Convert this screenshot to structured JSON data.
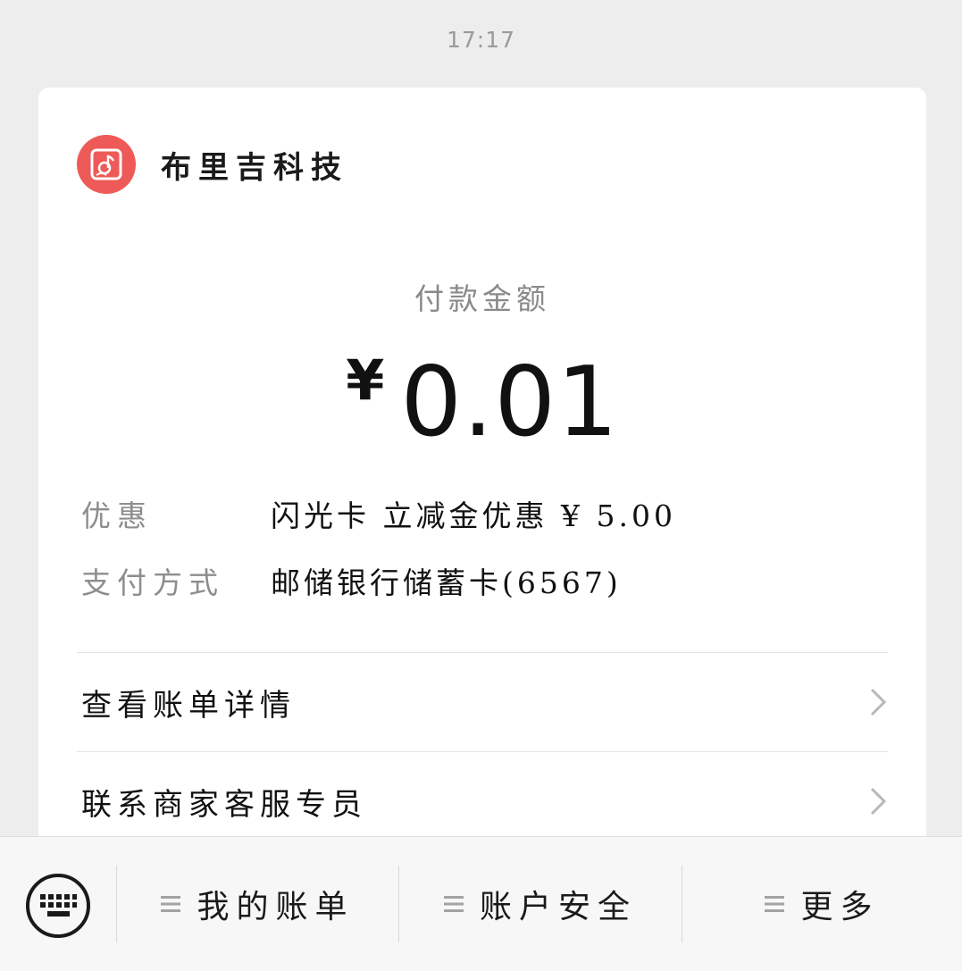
{
  "header": {
    "timestamp": "17:17"
  },
  "merchant": {
    "name": "布里吉科技",
    "logo_color": "#ee5a57",
    "logo_icon": "music-note-icon"
  },
  "payment": {
    "amount_label": "付款金额",
    "currency_symbol": "¥",
    "amount": "0.01"
  },
  "details": [
    {
      "label": "优惠",
      "value": "闪光卡 立减金优惠 ¥ 5.00"
    },
    {
      "label": "支付方式",
      "value": "邮储银行储蓄卡(6567)"
    }
  ],
  "links": [
    {
      "label": "查看账单详情",
      "icon": "chevron-right-icon"
    },
    {
      "label": "联系商家客服专员",
      "icon": "chevron-right-icon"
    }
  ],
  "bottom_menu": {
    "keyboard_icon": "keyboard-icon",
    "items": [
      {
        "label": "我的账单",
        "icon": "menu-lines-icon"
      },
      {
        "label": "账户安全",
        "icon": "menu-lines-icon"
      },
      {
        "label": "更多",
        "icon": "menu-lines-icon"
      }
    ]
  },
  "colors": {
    "page_background": "#ededed",
    "card_background": "#ffffff",
    "secondary_text": "#8d8d8d",
    "primary_text": "#111111"
  }
}
